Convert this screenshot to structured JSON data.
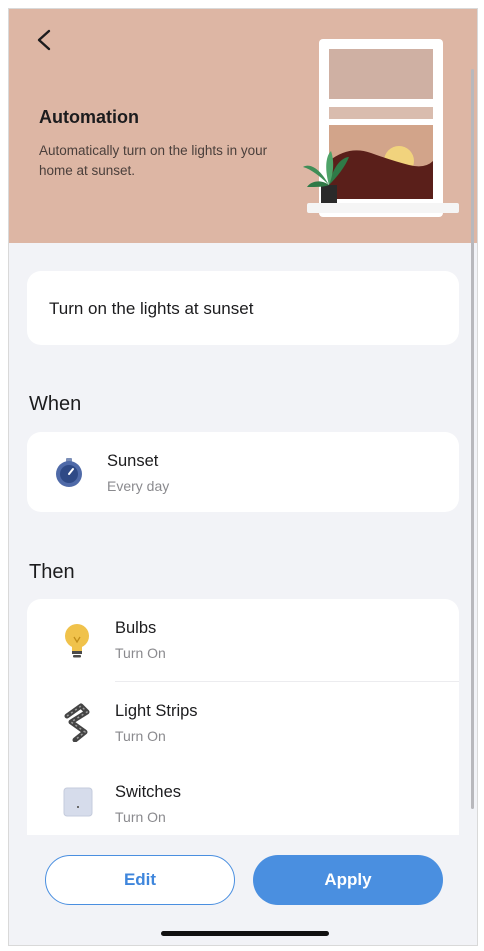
{
  "header": {
    "title": "Automation",
    "description": "Automatically turn on the lights in your home at sunset.",
    "background_color": "#ddb6a4"
  },
  "automation_name": "Turn on the lights at sunset",
  "when": {
    "title": "When",
    "trigger": {
      "icon": "sunset-clock-icon",
      "title": "Sunset",
      "subtitle": "Every day"
    }
  },
  "then": {
    "title": "Then",
    "actions": [
      {
        "icon": "bulb-icon",
        "title": "Bulbs",
        "subtitle": "Turn On"
      },
      {
        "icon": "light-strip-icon",
        "title": "Light Strips",
        "subtitle": "Turn On"
      },
      {
        "icon": "switch-icon",
        "title": "Switches",
        "subtitle": "Turn On"
      }
    ]
  },
  "buttons": {
    "edit": "Edit",
    "apply": "Apply"
  },
  "colors": {
    "accent": "#4a8fe0",
    "page_bg": "#f2f3f7"
  }
}
